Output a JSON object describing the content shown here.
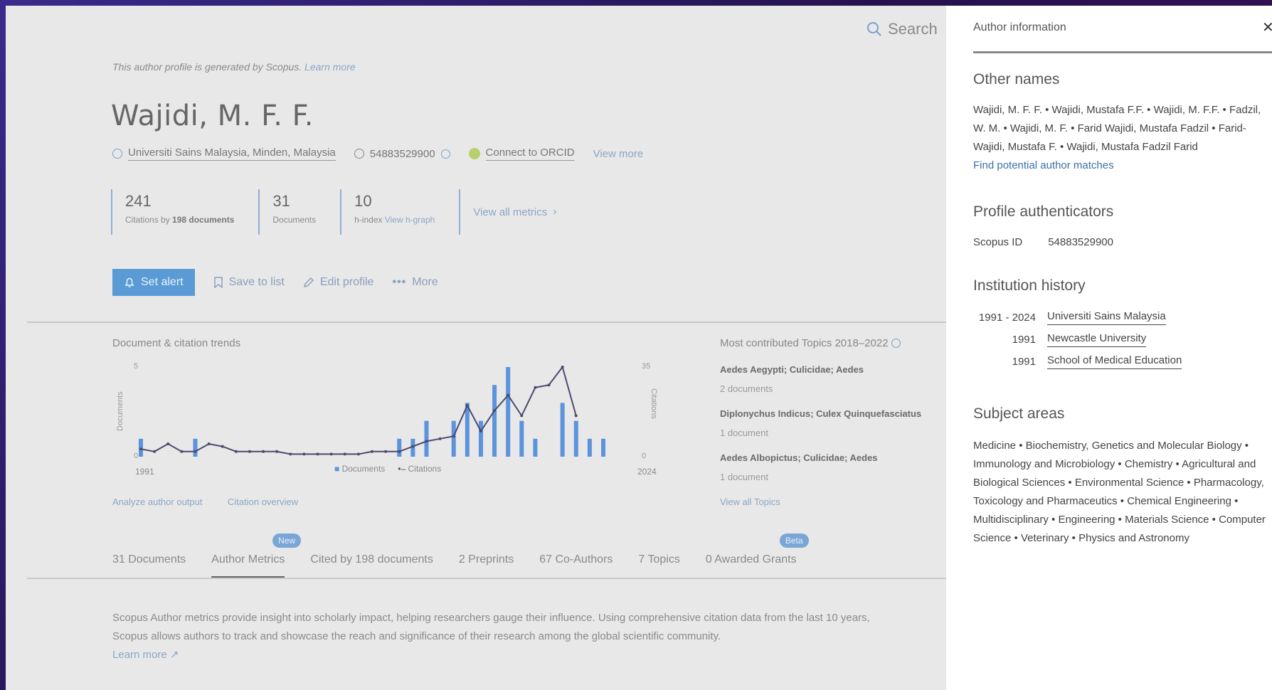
{
  "main": {
    "search_label": "Search",
    "notice": {
      "text": "This author profile is generated by Scopus.",
      "link": "Learn more"
    },
    "author_name": "Wajidi, M. F. F.",
    "affiliation": "Universiti Sains Malaysia, Minden, Malaysia",
    "scopus_id": "54883529900",
    "orcid_label": "Connect to ORCID",
    "view_more": "View more",
    "metrics": [
      {
        "value": "241",
        "label": "Citations by",
        "bold": "198 documents",
        "link": ""
      },
      {
        "value": "31",
        "label": "Documents",
        "bold": "",
        "link": ""
      },
      {
        "value": "10",
        "label": "h-index",
        "bold": "",
        "link": "View h-graph"
      }
    ],
    "view_all_metrics": "View all metrics",
    "actions": {
      "set_alert": "Set alert",
      "save_to_list": "Save to list",
      "edit_profile": "Edit profile",
      "more": "More"
    },
    "trends_title": "Document & citation trends",
    "analyze_link": "Analyze author output",
    "citation_overview_link": "Citation overview",
    "topics_title": "Most contributed Topics 2018–2022",
    "topics": [
      {
        "name": "Aedes Aegypti; Culicidae; Aedes",
        "docs": "2 documents"
      },
      {
        "name": "Diplonychus Indicus; Culex Quinquefasciatus",
        "docs": "1 document"
      },
      {
        "name": "Aedes Albopictus; Culicidae; Aedes",
        "docs": "1 document"
      }
    ],
    "view_all_topics": "View all Topics",
    "tabs": [
      {
        "label": "31 Documents",
        "badge": ""
      },
      {
        "label": "Author Metrics",
        "badge": "New"
      },
      {
        "label": "Cited by 198 documents",
        "badge": ""
      },
      {
        "label": "2 Preprints",
        "badge": ""
      },
      {
        "label": "67 Co-Authors",
        "badge": ""
      },
      {
        "label": "7 Topics",
        "badge": ""
      },
      {
        "label": "0 Awarded Grants",
        "badge": "Beta"
      }
    ],
    "description": "Scopus Author metrics provide insight into scholarly impact, helping researchers gauge their influence. Using comprehensive citation data from the last 10 years, Scopus allows authors to track and showcase the reach and significance of their research among the global scientific community.",
    "description_link": "Learn more"
  },
  "chart_data": {
    "type": "bar",
    "x_start": 1991,
    "x_end": 2024,
    "x_tick_labels": [
      "1991",
      "2024"
    ],
    "ylabel_left": "Documents",
    "ylabel_right": "Citations",
    "y_left_ticks": [
      "5",
      "0"
    ],
    "y_right_ticks": [
      "35",
      "0"
    ],
    "ylim_left": [
      0,
      5
    ],
    "ylim_right": [
      0,
      35
    ],
    "legend": [
      "Documents",
      "Citations"
    ],
    "legend_position": "bottom-center",
    "series": [
      {
        "name": "Documents",
        "kind": "bar",
        "color": "#5b93dc",
        "points": [
          [
            1991,
            1
          ],
          [
            1995,
            1
          ],
          [
            2010,
            1
          ],
          [
            2011,
            1
          ],
          [
            2012,
            2
          ],
          [
            2014,
            2
          ],
          [
            2015,
            3
          ],
          [
            2016,
            2
          ],
          [
            2017,
            4
          ],
          [
            2018,
            5
          ],
          [
            2019,
            2
          ],
          [
            2020,
            1
          ],
          [
            2022,
            3
          ],
          [
            2023,
            2
          ],
          [
            2024,
            1
          ],
          [
            2025,
            1
          ]
        ]
      },
      {
        "name": "Citations",
        "kind": "line",
        "color": "#4a4a70",
        "points": [
          [
            1991,
            3
          ],
          [
            1992,
            2
          ],
          [
            1993,
            5
          ],
          [
            1994,
            2
          ],
          [
            1995,
            2
          ],
          [
            1996,
            5
          ],
          [
            1997,
            4
          ],
          [
            1998,
            2
          ],
          [
            1999,
            2
          ],
          [
            2000,
            2
          ],
          [
            2001,
            2
          ],
          [
            2002,
            1
          ],
          [
            2003,
            1
          ],
          [
            2004,
            1
          ],
          [
            2005,
            1
          ],
          [
            2006,
            1
          ],
          [
            2007,
            1
          ],
          [
            2008,
            2
          ],
          [
            2009,
            2
          ],
          [
            2010,
            2
          ],
          [
            2011,
            4
          ],
          [
            2012,
            6
          ],
          [
            2013,
            7
          ],
          [
            2014,
            8
          ],
          [
            2015,
            20
          ],
          [
            2016,
            10
          ],
          [
            2017,
            18
          ],
          [
            2018,
            24
          ],
          [
            2019,
            16
          ],
          [
            2020,
            27
          ],
          [
            2021,
            28
          ],
          [
            2022,
            35
          ],
          [
            2023,
            16
          ]
        ]
      }
    ]
  },
  "panel": {
    "title": "Author information",
    "close_icon": "✕",
    "other_names_title": "Other names",
    "other_names": "Wajidi, M. F. F. • Wajidi, Mustafa F.F. • Wajidi, M. F.F. • Fadzil, W. M. • Wajidi, M. F. • Farid Wajidi, Mustafa Fadzil • Farid-Wajidi, Mustafa F. • Wajidi, Mustafa Fadzil Farid",
    "find_matches": "Find potential author matches",
    "authenticators_title": "Profile authenticators",
    "scopus_id_label": "Scopus ID",
    "scopus_id_value": "54883529900",
    "institution_title": "Institution history",
    "institutions": [
      {
        "years": "1991 - 2024",
        "name": "Universiti Sains Malaysia"
      },
      {
        "years": "1991",
        "name": "Newcastle University"
      },
      {
        "years": "1991",
        "name": "School of Medical Education"
      }
    ],
    "subject_title": "Subject areas",
    "subjects": "Medicine • Biochemistry, Genetics and Molecular Biology • Immunology and Microbiology • Chemistry • Agricultural and Biological Sciences • Environmental Science • Pharmacology, Toxicology and Pharmaceutics • Chemical Engineering • Multidisciplinary • Engineering • Materials Science • Computer Science • Veterinary • Physics and Astronomy"
  }
}
